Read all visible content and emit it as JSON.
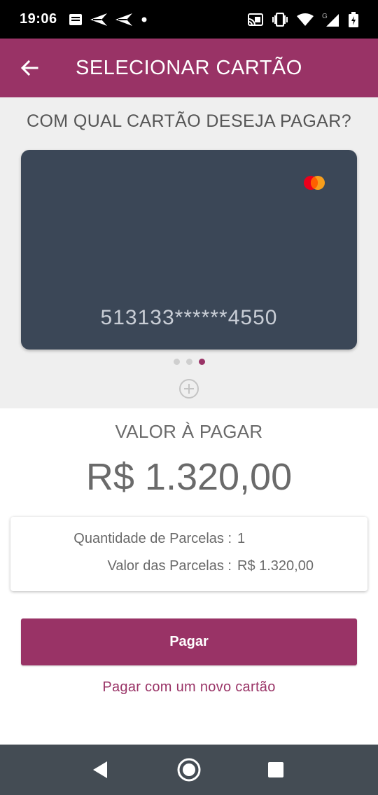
{
  "status_bar": {
    "time": "19:06",
    "left_icons": [
      "message-icon",
      "send-icon",
      "send-icon",
      "dot-icon"
    ],
    "right_icons": [
      "cast-icon",
      "vibrate-icon",
      "wifi-icon",
      "signal-icon",
      "battery-icon"
    ],
    "network_label": "G"
  },
  "app_bar": {
    "back_icon": "arrow-back-icon",
    "title": "SELECIONAR CARTÃO"
  },
  "card_selector": {
    "question": "COM QUAL CARTÃO DESEJA PAGAR?",
    "card": {
      "brand_icon": "mastercard-icon",
      "number": "513133******4550"
    },
    "pager": {
      "count": 3,
      "active_index": 2
    },
    "add_icon": "add-circle-icon"
  },
  "payment": {
    "amount_label": "VALOR À PAGAR",
    "amount": "R$ 1.320,00"
  },
  "installments": {
    "quantity_label": "Quantidade de Parcelas :",
    "quantity_value": "1",
    "value_label": "Valor das Parcelas :",
    "value_value": "R$ 1.320,00"
  },
  "actions": {
    "pay_label": "Pagar",
    "new_card_label": "Pagar com um novo cartão"
  },
  "nav_bar": {
    "icons": [
      "back-triangle-icon",
      "home-circle-icon",
      "recents-square-icon"
    ]
  },
  "colors": {
    "primary": "#993366",
    "card_bg": "#3b4757",
    "section_bg": "#efefef",
    "nav_bg": "#444c54"
  }
}
